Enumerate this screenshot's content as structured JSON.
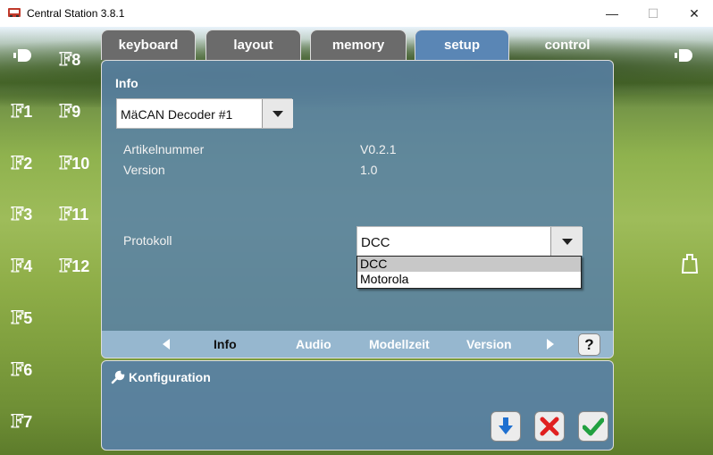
{
  "window": {
    "title": "Central Station 3.8.1",
    "min_glyph": "—",
    "max_glyph": "☐",
    "close_glyph": "✕"
  },
  "tabs": [
    {
      "label": "keyboard",
      "state": "inactive"
    },
    {
      "label": "layout",
      "state": "inactive"
    },
    {
      "label": "memory",
      "state": "inactive"
    },
    {
      "label": "setup",
      "state": "active"
    },
    {
      "label": "control",
      "state": "ghost"
    }
  ],
  "fkeys": {
    "left": [
      "F1",
      "F2",
      "F3",
      "F4",
      "F5",
      "F6",
      "F7"
    ],
    "right": [
      "F8",
      "F9",
      "F10",
      "F11",
      "F12"
    ]
  },
  "info": {
    "heading": "Info",
    "decoder_value": "MäCAN Decoder #1",
    "article_label": "Artikelnummer",
    "article_value": "V0.2.1",
    "version_label": "Version",
    "version_value": "1.0",
    "protocol_label": "Protokoll",
    "protocol_value": "DCC",
    "protocol_options": [
      "DCC",
      "Motorola"
    ]
  },
  "subnav": {
    "items": [
      "Info",
      "Audio",
      "Modellzeit",
      "Version"
    ],
    "current": "Info",
    "help": "?"
  },
  "konfig": {
    "heading": "Konfiguration"
  },
  "colors": {
    "panel": "#5a86b5",
    "tab_inactive": "#6b6b6b",
    "download": "#1e6fd0",
    "cancel": "#e02020",
    "confirm": "#21a040"
  }
}
